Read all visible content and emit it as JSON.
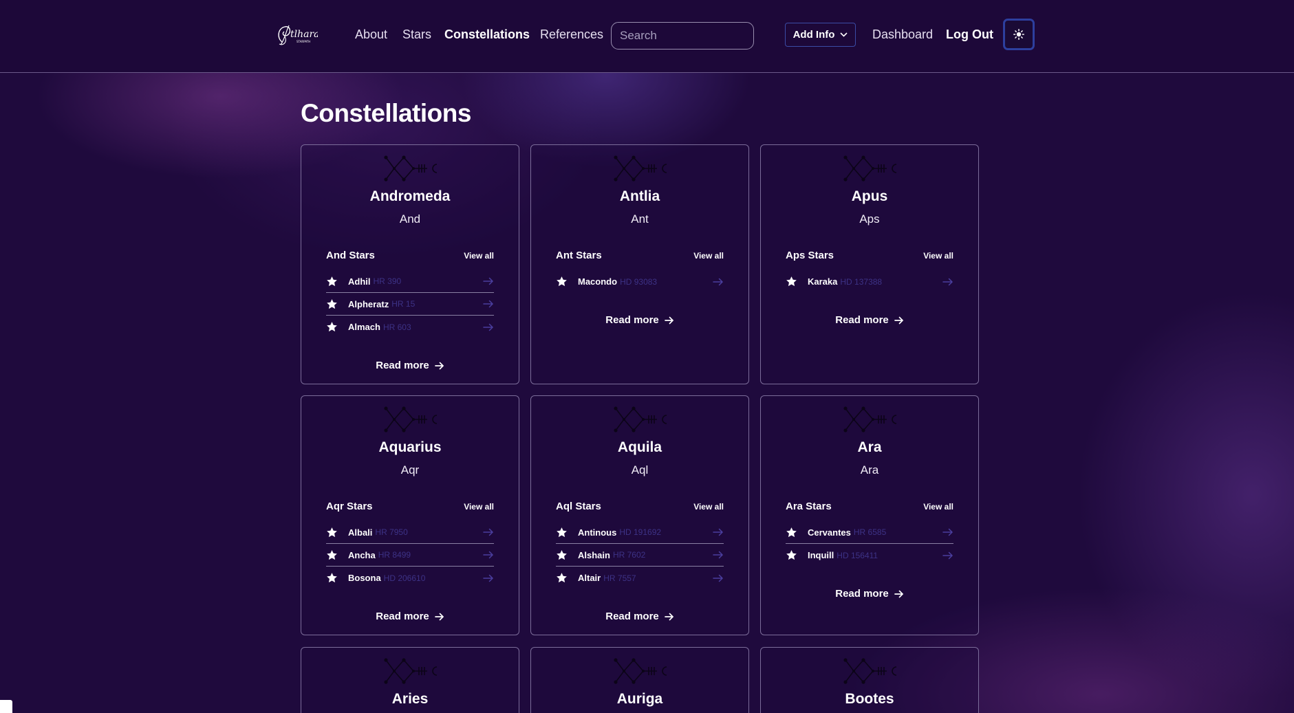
{
  "nav": {
    "logo_icon": "astara-logo-icon",
    "links": [
      "About",
      "Stars",
      "Constellations",
      "References"
    ],
    "active_link": "Constellations",
    "search_placeholder": "Search",
    "add_info_label": "Add Info",
    "dashboard_label": "Dashboard",
    "logout_label": "Log Out",
    "theme_icon": "sun-icon"
  },
  "page": {
    "title": "Constellations"
  },
  "colors": {
    "background": "#1f0a3d",
    "card_border": "#7c6d9a",
    "star_id": "#3d3286",
    "arrow": "#4a3e9e",
    "button_border": "#2d3f9e"
  },
  "cards": [
    {
      "name": "Andromeda",
      "abbr": "And",
      "stars_title": "And Stars",
      "view_all": "View all",
      "stars": [
        {
          "name": "Adhil",
          "id": "HR 390"
        },
        {
          "name": "Alpheratz",
          "id": "HR 15"
        },
        {
          "name": "Almach",
          "id": "HR 603"
        }
      ],
      "read_more": "Read more"
    },
    {
      "name": "Antlia",
      "abbr": "Ant",
      "stars_title": "Ant Stars",
      "view_all": "View all",
      "stars": [
        {
          "name": "Macondo",
          "id": "HD 93083"
        }
      ],
      "read_more": "Read more"
    },
    {
      "name": "Apus",
      "abbr": "Aps",
      "stars_title": "Aps Stars",
      "view_all": "View all",
      "stars": [
        {
          "name": "Karaka",
          "id": "HD 137388"
        }
      ],
      "read_more": "Read more"
    },
    {
      "name": "Aquarius",
      "abbr": "Aqr",
      "stars_title": "Aqr Stars",
      "view_all": "View all",
      "stars": [
        {
          "name": "Albali",
          "id": "HR 7950"
        },
        {
          "name": "Ancha",
          "id": "HR 8499"
        },
        {
          "name": "Bosona",
          "id": "HD 206610"
        }
      ],
      "read_more": "Read more"
    },
    {
      "name": "Aquila",
      "abbr": "Aql",
      "stars_title": "Aql Stars",
      "view_all": "View all",
      "stars": [
        {
          "name": "Antinous",
          "id": "HD 191692"
        },
        {
          "name": "Alshain",
          "id": "HR 7602"
        },
        {
          "name": "Altair",
          "id": "HR 7557"
        }
      ],
      "read_more": "Read more"
    },
    {
      "name": "Ara",
      "abbr": "Ara",
      "stars_title": "Ara Stars",
      "view_all": "View all",
      "stars": [
        {
          "name": "Cervantes",
          "id": "HR 6585"
        },
        {
          "name": "Inquill",
          "id": "HD 156411"
        }
      ],
      "read_more": "Read more"
    },
    {
      "name": "Aries"
    },
    {
      "name": "Auriga"
    },
    {
      "name": "Bootes"
    }
  ]
}
